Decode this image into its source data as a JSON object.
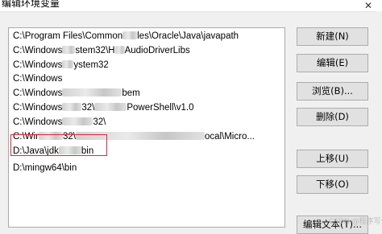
{
  "window": {
    "title": "编辑环境变量",
    "close_glyph": "✕"
  },
  "paths": [
    {
      "parts": [
        "C:\\Program Files\\Common",
        "",
        "les\\Oracle\\Java\\javapath"
      ]
    },
    {
      "parts": [
        "C:\\Windows",
        "",
        "stem32\\H",
        "",
        "AudioDriverLibs"
      ]
    },
    {
      "parts": [
        "C:\\Windows",
        "",
        "ystem32"
      ]
    },
    {
      "parts": [
        "C:\\Windows"
      ]
    },
    {
      "parts": [
        "C:\\Windows",
        "",
        "bem"
      ]
    },
    {
      "parts": [
        "C:\\Windows",
        "",
        "32\\",
        "",
        "PowerShell\\v1.0"
      ]
    },
    {
      "parts": [
        "C:\\Windows",
        "",
        "32\\"
      ]
    },
    {
      "parts": [
        "C:\\Wir",
        "",
        "32\\",
        "",
        "ocal\\Micro..."
      ]
    },
    {
      "parts": [
        "D:\\Java\\jdk",
        "",
        "bin"
      ]
    },
    {
      "parts": [
        "D:\\mingw64\\bin"
      ]
    }
  ],
  "buttons": {
    "new": "新建(N)",
    "edit": "编辑(E)",
    "browse": "浏览(B)...",
    "delete": "删除(D)",
    "move_up": "上移(U)",
    "move_down": "下移(O)",
    "edit_text": "编辑文本(T)..."
  },
  "watermark": "CSDN @程序写代码",
  "colors": {
    "highlight_border": "#e0263a",
    "button_bg": "#e1e1e1"
  }
}
